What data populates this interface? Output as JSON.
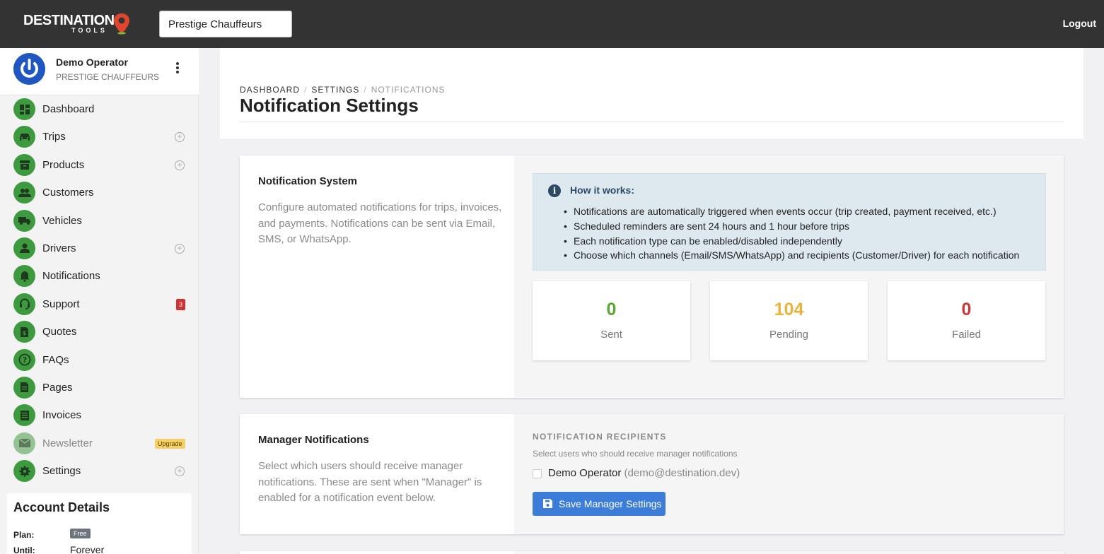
{
  "topbar": {
    "logo_main": "DESTINATION",
    "logo_sub": "TOOLS",
    "tenant_value": "Prestige Chauffeurs",
    "logout_label": "Logout"
  },
  "user": {
    "name": "Demo Operator",
    "org": "PRESTIGE CHAUFFEURS"
  },
  "sidebar": {
    "items": [
      {
        "label": "Dashboard",
        "icon": "dashboard-icon"
      },
      {
        "label": "Trips",
        "icon": "car-icon",
        "plus": true
      },
      {
        "label": "Products",
        "icon": "archive-icon",
        "plus": true
      },
      {
        "label": "Customers",
        "icon": "people-icon"
      },
      {
        "label": "Vehicles",
        "icon": "truck-icon"
      },
      {
        "label": "Drivers",
        "icon": "person-icon",
        "plus": true
      },
      {
        "label": "Notifications",
        "icon": "bell-icon"
      },
      {
        "label": "Support",
        "icon": "headset-icon",
        "badge": "3"
      },
      {
        "label": "Quotes",
        "icon": "quote-icon"
      },
      {
        "label": "FAQs",
        "icon": "question-icon"
      },
      {
        "label": "Pages",
        "icon": "file-icon"
      },
      {
        "label": "Invoices",
        "icon": "invoice-icon"
      },
      {
        "label": "Newsletter",
        "icon": "mail-icon",
        "upgrade": "Upgrade"
      },
      {
        "label": "Settings",
        "icon": "gear-icon",
        "plus": true
      }
    ]
  },
  "account": {
    "title": "Account Details",
    "plan_label": "Plan:",
    "plan_value": "Free",
    "until_label": "Until:",
    "until_value": "Forever"
  },
  "header": {
    "breadcrumb": [
      "DASHBOARD",
      "SETTINGS",
      "NOTIFICATIONS"
    ],
    "title": "Notification Settings"
  },
  "system_card": {
    "title": "Notification System",
    "description": "Configure automated notifications for trips, invoices, and payments. Notifications can be sent via Email, SMS, or WhatsApp.",
    "info_title": "How it works:",
    "info_items": [
      "Notifications are automatically triggered when events occur (trip created, payment received, etc.)",
      "Scheduled reminders are sent 24 hours and 1 hour before trips",
      "Each notification type can be enabled/disabled independently",
      "Choose which channels (Email/SMS/WhatsApp) and recipients (Customer/Driver) for each notification"
    ],
    "stats": [
      {
        "value": "0",
        "label": "Sent",
        "color": "#5aa832"
      },
      {
        "value": "104",
        "label": "Pending",
        "color": "#eab33d"
      },
      {
        "value": "0",
        "label": "Failed",
        "color": "#c83a3a"
      }
    ]
  },
  "manager_card": {
    "title": "Manager Notifications",
    "description": "Select which users should receive manager notifications. These are sent when \"Manager\" is enabled for a notification event below.",
    "recipients_heading": "NOTIFICATION RECIPIENTS",
    "recipients_sub": "Select users who should receive manager notifications",
    "recipient_name": "Demo Operator",
    "recipient_email": "(demo@destination.dev)",
    "save_label": "Save Manager Settings"
  }
}
